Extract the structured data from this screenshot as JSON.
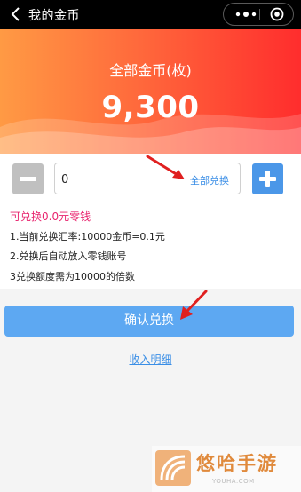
{
  "nav": {
    "title": "我的金币"
  },
  "banner": {
    "label": "全部金币(枚)",
    "value": "9,300"
  },
  "exchange": {
    "amount_value": "0",
    "all_label": "全部兑换",
    "available_text": "可兑换0.0元零钱",
    "rules": [
      "1.当前兑换汇率:10000金币=0.1元",
      "2.兑换后自动放入零钱账号",
      "3兑换额度需为10000的倍数"
    ]
  },
  "actions": {
    "confirm_label": "确认兑换",
    "detail_link": "收入明细"
  },
  "watermark": {
    "brand": "悠哈手游",
    "url": "YOUHA.COM"
  },
  "colors": {
    "accent_blue": "#4b97e8",
    "banner_start": "#ff9a44",
    "banner_end": "#ff2d2d",
    "available_pink": "#e8246e",
    "annotation_red": "#e02020"
  }
}
